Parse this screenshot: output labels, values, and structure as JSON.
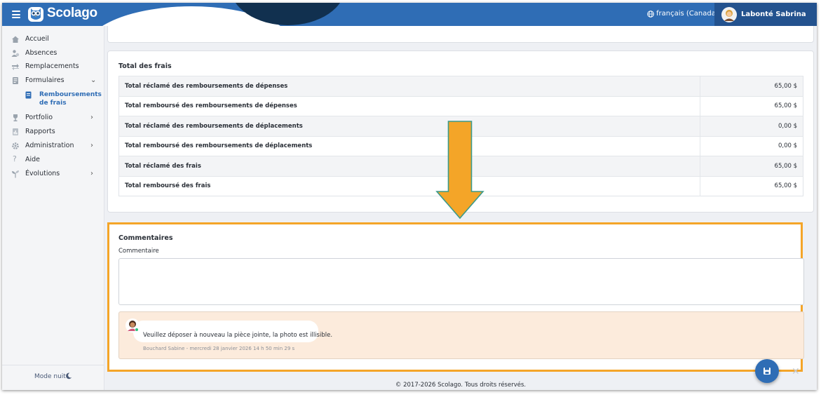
{
  "header": {
    "brand": "Scolago",
    "language": "français (Canada)",
    "user_name": "Labonté Sabrina"
  },
  "sidebar": {
    "items": [
      {
        "label": "Accueil",
        "icon": "home-icon"
      },
      {
        "label": "Absences",
        "icon": "absences-icon"
      },
      {
        "label": "Remplacements",
        "icon": "replacements-icon"
      },
      {
        "label": "Formulaires",
        "icon": "forms-icon",
        "expanded": true
      },
      {
        "label": "Portfolio",
        "icon": "trophy-icon"
      },
      {
        "label": "Rapports",
        "icon": "reports-icon"
      },
      {
        "label": "Administration",
        "icon": "gear-icon"
      },
      {
        "label": "Aide",
        "icon": "question-icon"
      },
      {
        "label": "Évolutions",
        "icon": "sprout-icon"
      }
    ],
    "sub_item": {
      "label": "Remboursements de frais",
      "icon": "document-icon",
      "active": true
    },
    "night_mode": "Mode nuit"
  },
  "fees": {
    "title": "Total des frais",
    "rows": [
      {
        "label": "Total réclamé des remboursements de dépenses",
        "value": "65,00 $"
      },
      {
        "label": "Total remboursé des remboursements de dépenses",
        "value": "65,00 $"
      },
      {
        "label": "Total réclamé des remboursements de déplacements",
        "value": "0,00 $"
      },
      {
        "label": "Total remboursé des remboursements de déplacements",
        "value": "0,00 $"
      },
      {
        "label": "Total réclamé des frais",
        "value": "65,00 $"
      },
      {
        "label": "Total remboursé des frais",
        "value": "65,00 $"
      }
    ]
  },
  "comments": {
    "title": "Commentaires",
    "field_label": "Commentaire",
    "field_value": "",
    "message": "Veuillez déposer à nouveau la pièce jointe, la photo est illisible.",
    "meta": "Bouchard Sabine - mercredi 28 janvier 2026 14 h 50 min 29 s"
  },
  "footer": "© 2017-2026 Scolago. Tous droits réservés.",
  "colors": {
    "brand_blue": "#2f6db5",
    "highlight_orange": "#f4a528",
    "comment_bg": "#fcebdc"
  }
}
